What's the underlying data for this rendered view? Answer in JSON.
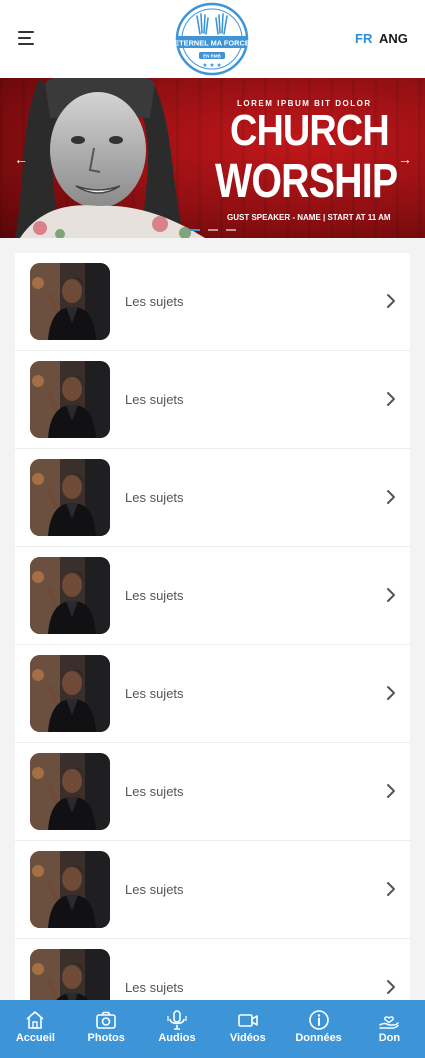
{
  "header": {
    "logo_text": "ETERNEL MA FORCE",
    "logo_subtext": "EN RMB",
    "lang_fr": "FR",
    "lang_ang": "ANG",
    "accent_color": "#2e8fd6"
  },
  "banner": {
    "kicker": "LOREM IPBUM BIT DOLOR",
    "title_line_1": "CHURCH",
    "title_line_2": "WORSHIP",
    "subtitle": "GUST SPEAKER - NAME | START AT 11 AM",
    "arrow_left_icon": "arrow-left-icon",
    "arrow_right_icon": "arrow-right-icon",
    "active_slide": 1,
    "slide_count": 3,
    "background_color": "#a81216"
  },
  "list": {
    "items": [
      {
        "label": "Les sujets"
      },
      {
        "label": "Les sujets"
      },
      {
        "label": "Les sujets"
      },
      {
        "label": "Les sujets"
      },
      {
        "label": "Les sujets"
      },
      {
        "label": "Les sujets"
      },
      {
        "label": "Les sujets"
      },
      {
        "label": "Les sujets"
      }
    ]
  },
  "bottom_nav": {
    "background_color": "#3d95d8",
    "items": [
      {
        "label": "Accueil",
        "icon": "home-icon"
      },
      {
        "label": "Photos",
        "icon": "camera-icon"
      },
      {
        "label": "Audios",
        "icon": "microphone-icon"
      },
      {
        "label": "Vidéos",
        "icon": "video-icon"
      },
      {
        "label": "Données",
        "icon": "info-icon"
      },
      {
        "label": "Don",
        "icon": "donate-hand-icon"
      }
    ]
  }
}
